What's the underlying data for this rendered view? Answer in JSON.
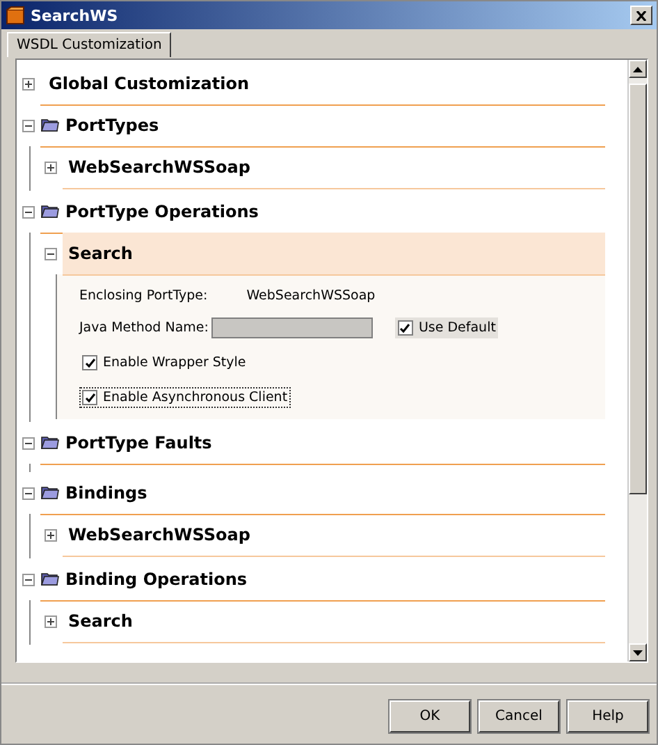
{
  "window": {
    "title": "SearchWS"
  },
  "tabs": [
    {
      "label": "WSDL Customization",
      "selected": true
    }
  ],
  "tree": [
    {
      "label": "Global Customization",
      "kind": "plain",
      "expanded": false
    },
    {
      "label": "PortTypes",
      "kind": "folder",
      "expanded": true,
      "children": [
        {
          "label": "WebSearchWSSoap",
          "expanded": false
        }
      ]
    },
    {
      "label": "PortType Operations",
      "kind": "folder",
      "expanded": true,
      "children": [
        {
          "label": "Search",
          "expanded": true,
          "details": {
            "enclosing_label": "Enclosing PortType:",
            "enclosing_value": "WebSearchWSSoap",
            "method_label": "Java Method Name:",
            "use_default": {
              "label": "Use Default",
              "checked": true
            },
            "options": [
              {
                "label": "Enable Wrapper Style",
                "checked": true,
                "focused": false
              },
              {
                "label": "Enable Asynchronous Client",
                "checked": true,
                "focused": true
              }
            ]
          }
        }
      ]
    },
    {
      "label": "PortType Faults",
      "kind": "folder",
      "expanded": true
    },
    {
      "label": "Bindings",
      "kind": "folder",
      "expanded": true,
      "children": [
        {
          "label": "WebSearchWSSoap",
          "expanded": false
        }
      ]
    },
    {
      "label": "Binding Operations",
      "kind": "folder",
      "expanded": true,
      "children": [
        {
          "label": "Search",
          "expanded": false
        }
      ]
    }
  ],
  "buttons": [
    "OK",
    "Cancel",
    "Help"
  ]
}
